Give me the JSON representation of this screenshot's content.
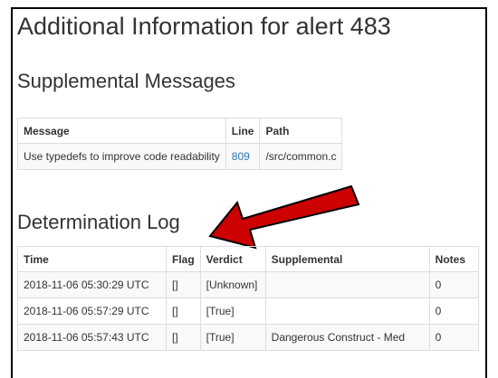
{
  "page": {
    "title": "Additional Information for alert 483"
  },
  "supplemental": {
    "heading": "Supplemental Messages",
    "columns": [
      "Message",
      "Line",
      "Path"
    ],
    "rows": [
      {
        "message": "Use typedefs to improve code readability",
        "line": "809",
        "path": "/src/common.c"
      }
    ]
  },
  "determination": {
    "heading": "Determination Log",
    "columns": [
      "Time",
      "Flag",
      "Verdict",
      "Supplemental",
      "Notes"
    ],
    "rows": [
      {
        "time": "2018-11-06 05:30:29 UTC",
        "flag": "[]",
        "verdict": "[Unknown]",
        "supplemental": "",
        "notes": "0"
      },
      {
        "time": "2018-11-06 05:57:29 UTC",
        "flag": "[]",
        "verdict": "[True]",
        "supplemental": "",
        "notes": "0"
      },
      {
        "time": "2018-11-06 05:57:43 UTC",
        "flag": "[]",
        "verdict": "[True]",
        "supplemental": "Dangerous Construct - Med",
        "notes": "0"
      }
    ]
  },
  "annotation": {
    "arrow_color": "#cc0000"
  }
}
